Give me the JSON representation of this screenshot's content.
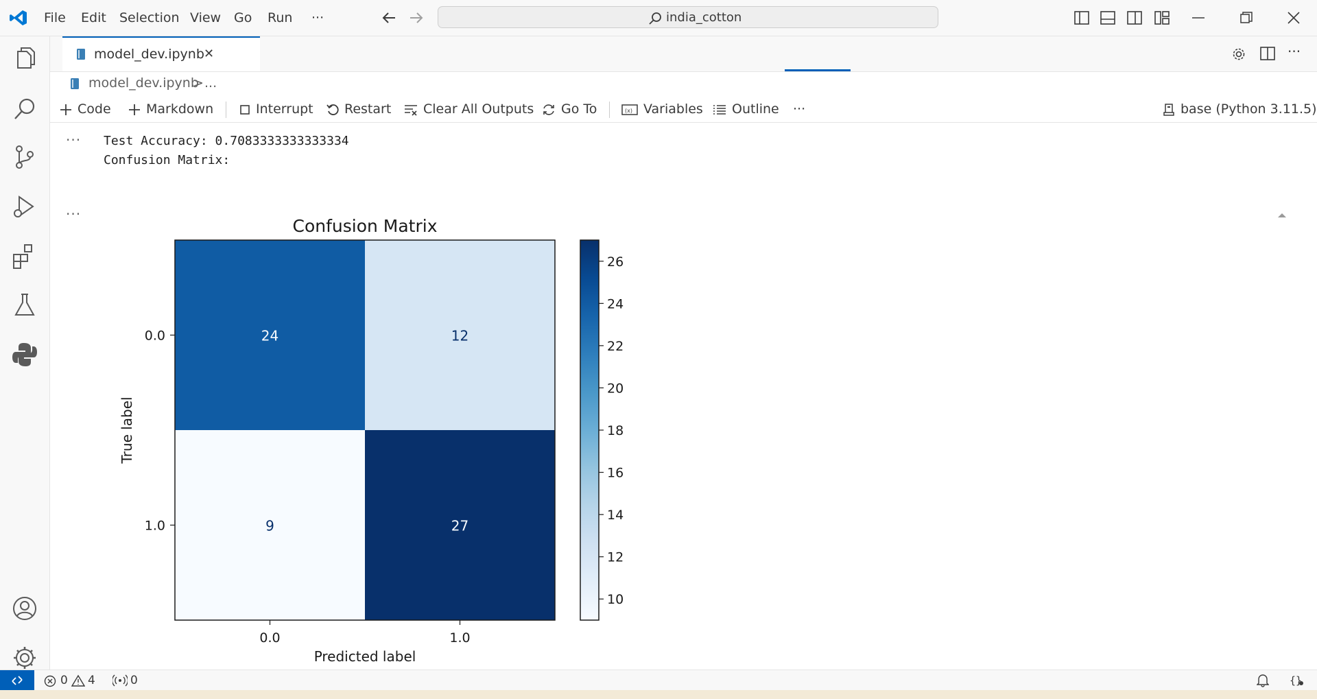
{
  "menu": {
    "items": [
      "File",
      "Edit",
      "Selection",
      "View",
      "Go",
      "Run"
    ],
    "more": "···"
  },
  "search": {
    "label": "india_cotton"
  },
  "tab": {
    "name": "model_dev.ipynb",
    "close": "✕"
  },
  "breadcrumb": {
    "file": "model_dev.ipynb",
    "sep": ">",
    "more": "..."
  },
  "toolbar": {
    "code": "Code",
    "markdown": "Markdown",
    "interrupt": "Interrupt",
    "restart": "Restart",
    "clear_outputs": "Clear All Outputs",
    "goto": "Go To",
    "variables": "Variables",
    "outline": "Outline",
    "more": "···",
    "kernel": "base (Python 3.11.5)"
  },
  "output": {
    "ellipsis": "···",
    "line1": "Test Accuracy: 0.7083333333333334",
    "line2": "Confusion Matrix:"
  },
  "status": {
    "errors": "0",
    "warnings": "4",
    "ports": "0"
  },
  "chart_data": {
    "type": "heatmap",
    "title": "Confusion Matrix",
    "xlabel": "Predicted label",
    "ylabel": "True label",
    "x_ticks": [
      "0.0",
      "1.0"
    ],
    "y_ticks": [
      "0.0",
      "1.0"
    ],
    "matrix": [
      [
        24,
        12
      ],
      [
        9,
        27
      ]
    ],
    "colormap": "Blues",
    "colorbar": {
      "range": [
        9,
        27
      ],
      "ticks": [
        10,
        12,
        14,
        16,
        18,
        20,
        22,
        24,
        26
      ]
    }
  }
}
